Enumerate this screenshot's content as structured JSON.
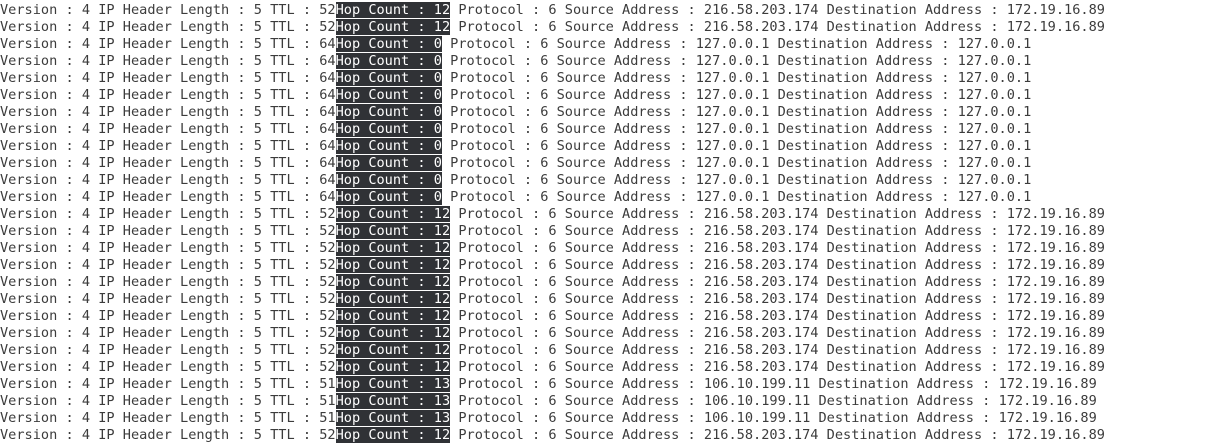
{
  "labels": {
    "version": "Version : ",
    "ihl": " IP Header Length : ",
    "ttl": " TTL : ",
    "hop": "Hop Count : ",
    "protocol": " Protocol : ",
    "src": " Source Address : ",
    "dst": " Destination Address : "
  },
  "lines": [
    {
      "version": "4",
      "ihl": "5",
      "ttl": "52",
      "hop": "12",
      "protocol": "6",
      "src": "216.58.203.174",
      "dst": "172.19.16.89"
    },
    {
      "version": "4",
      "ihl": "5",
      "ttl": "52",
      "hop": "12",
      "protocol": "6",
      "src": "216.58.203.174",
      "dst": "172.19.16.89"
    },
    {
      "version": "4",
      "ihl": "5",
      "ttl": "64",
      "hop": "0",
      "protocol": "6",
      "src": "127.0.0.1",
      "dst": "127.0.0.1"
    },
    {
      "version": "4",
      "ihl": "5",
      "ttl": "64",
      "hop": "0",
      "protocol": "6",
      "src": "127.0.0.1",
      "dst": "127.0.0.1"
    },
    {
      "version": "4",
      "ihl": "5",
      "ttl": "64",
      "hop": "0",
      "protocol": "6",
      "src": "127.0.0.1",
      "dst": "127.0.0.1"
    },
    {
      "version": "4",
      "ihl": "5",
      "ttl": "64",
      "hop": "0",
      "protocol": "6",
      "src": "127.0.0.1",
      "dst": "127.0.0.1"
    },
    {
      "version": "4",
      "ihl": "5",
      "ttl": "64",
      "hop": "0",
      "protocol": "6",
      "src": "127.0.0.1",
      "dst": "127.0.0.1"
    },
    {
      "version": "4",
      "ihl": "5",
      "ttl": "64",
      "hop": "0",
      "protocol": "6",
      "src": "127.0.0.1",
      "dst": "127.0.0.1"
    },
    {
      "version": "4",
      "ihl": "5",
      "ttl": "64",
      "hop": "0",
      "protocol": "6",
      "src": "127.0.0.1",
      "dst": "127.0.0.1"
    },
    {
      "version": "4",
      "ihl": "5",
      "ttl": "64",
      "hop": "0",
      "protocol": "6",
      "src": "127.0.0.1",
      "dst": "127.0.0.1"
    },
    {
      "version": "4",
      "ihl": "5",
      "ttl": "64",
      "hop": "0",
      "protocol": "6",
      "src": "127.0.0.1",
      "dst": "127.0.0.1"
    },
    {
      "version": "4",
      "ihl": "5",
      "ttl": "64",
      "hop": "0",
      "protocol": "6",
      "src": "127.0.0.1",
      "dst": "127.0.0.1"
    },
    {
      "version": "4",
      "ihl": "5",
      "ttl": "52",
      "hop": "12",
      "protocol": "6",
      "src": "216.58.203.174",
      "dst": "172.19.16.89"
    },
    {
      "version": "4",
      "ihl": "5",
      "ttl": "52",
      "hop": "12",
      "protocol": "6",
      "src": "216.58.203.174",
      "dst": "172.19.16.89"
    },
    {
      "version": "4",
      "ihl": "5",
      "ttl": "52",
      "hop": "12",
      "protocol": "6",
      "src": "216.58.203.174",
      "dst": "172.19.16.89"
    },
    {
      "version": "4",
      "ihl": "5",
      "ttl": "52",
      "hop": "12",
      "protocol": "6",
      "src": "216.58.203.174",
      "dst": "172.19.16.89"
    },
    {
      "version": "4",
      "ihl": "5",
      "ttl": "52",
      "hop": "12",
      "protocol": "6",
      "src": "216.58.203.174",
      "dst": "172.19.16.89"
    },
    {
      "version": "4",
      "ihl": "5",
      "ttl": "52",
      "hop": "12",
      "protocol": "6",
      "src": "216.58.203.174",
      "dst": "172.19.16.89"
    },
    {
      "version": "4",
      "ihl": "5",
      "ttl": "52",
      "hop": "12",
      "protocol": "6",
      "src": "216.58.203.174",
      "dst": "172.19.16.89"
    },
    {
      "version": "4",
      "ihl": "5",
      "ttl": "52",
      "hop": "12",
      "protocol": "6",
      "src": "216.58.203.174",
      "dst": "172.19.16.89"
    },
    {
      "version": "4",
      "ihl": "5",
      "ttl": "52",
      "hop": "12",
      "protocol": "6",
      "src": "216.58.203.174",
      "dst": "172.19.16.89"
    },
    {
      "version": "4",
      "ihl": "5",
      "ttl": "52",
      "hop": "12",
      "protocol": "6",
      "src": "216.58.203.174",
      "dst": "172.19.16.89"
    },
    {
      "version": "4",
      "ihl": "5",
      "ttl": "51",
      "hop": "13",
      "protocol": "6",
      "src": "106.10.199.11",
      "dst": "172.19.16.89"
    },
    {
      "version": "4",
      "ihl": "5",
      "ttl": "51",
      "hop": "13",
      "protocol": "6",
      "src": "106.10.199.11",
      "dst": "172.19.16.89"
    },
    {
      "version": "4",
      "ihl": "5",
      "ttl": "51",
      "hop": "13",
      "protocol": "6",
      "src": "106.10.199.11",
      "dst": "172.19.16.89"
    },
    {
      "version": "4",
      "ihl": "5",
      "ttl": "52",
      "hop": "12",
      "protocol": "6",
      "src": "216.58.203.174",
      "dst": "172.19.16.89"
    }
  ]
}
